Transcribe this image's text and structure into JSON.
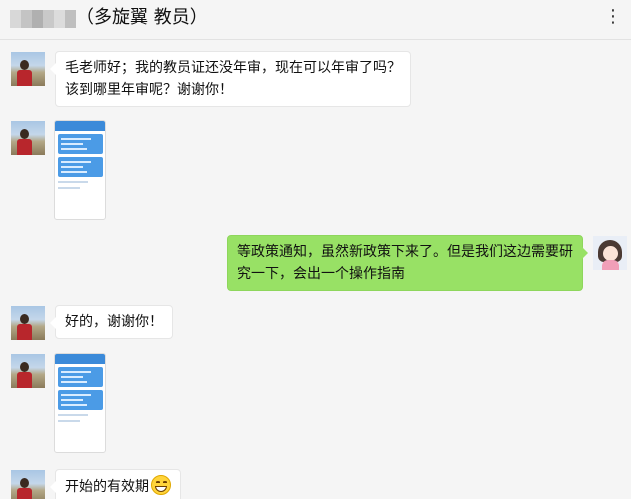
{
  "header": {
    "title": "（多旋翼 教员）",
    "more_icon": "⋮"
  },
  "messages": [
    {
      "sender": "teacher",
      "type": "text",
      "lines": [
        "毛老师好；我的教员证还没年审，现在可以年审了吗？",
        "该到哪里年审呢？谢谢你！"
      ]
    },
    {
      "sender": "teacher",
      "type": "image",
      "image_icon": "screenshot-thumbnail"
    },
    {
      "sender": "me",
      "type": "text",
      "lines": [
        "等政策通知，虽然新政策下来了。但是我们这边需要研",
        "究一下，会出一个操作指南"
      ]
    },
    {
      "sender": "teacher",
      "type": "text",
      "lines": [
        "好的，谢谢你！"
      ]
    },
    {
      "sender": "teacher",
      "type": "image",
      "image_icon": "screenshot-thumbnail"
    },
    {
      "sender": "teacher",
      "type": "text",
      "lines": [
        "开始的有效期"
      ],
      "emoji": "grinning-face-emoji"
    }
  ],
  "colors": {
    "background": "#f5f5f5",
    "incoming_bubble": "#ffffff",
    "outgoing_bubble": "#98e165"
  }
}
